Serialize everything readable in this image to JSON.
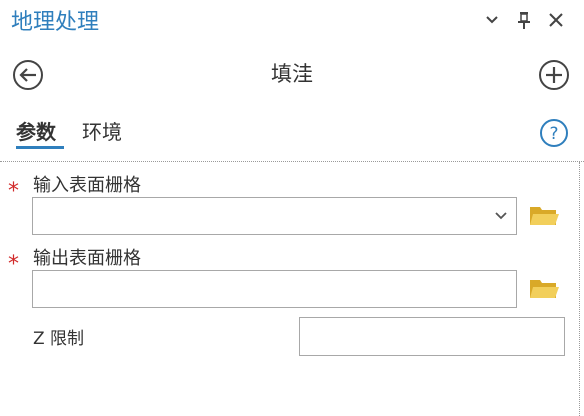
{
  "pane": {
    "title": "地理处理",
    "controls": {
      "options_icon": "chevron-down-icon",
      "pin_icon": "pin-icon",
      "close_icon": "close-icon"
    }
  },
  "tool": {
    "title": "填洼",
    "back_icon": "back-arrow-icon",
    "add_icon": "add-icon"
  },
  "tabs": [
    {
      "label": "参数",
      "active": true
    },
    {
      "label": "环境",
      "active": false
    }
  ],
  "help_icon": "help-icon",
  "parameters": [
    {
      "label": "输入表面栅格",
      "required": true,
      "value": "",
      "control": "dropdown",
      "browse_icon": "folder-icon"
    },
    {
      "label": "输出表面栅格",
      "required": true,
      "value": "",
      "control": "text",
      "browse_icon": "folder-icon"
    },
    {
      "label": "Z  限制",
      "required": false,
      "value": "",
      "control": "text"
    }
  ],
  "required_marker": "*",
  "colors": {
    "accent": "#2f7fbd",
    "required": "#d12a2a",
    "folder": "#e6c14a"
  }
}
